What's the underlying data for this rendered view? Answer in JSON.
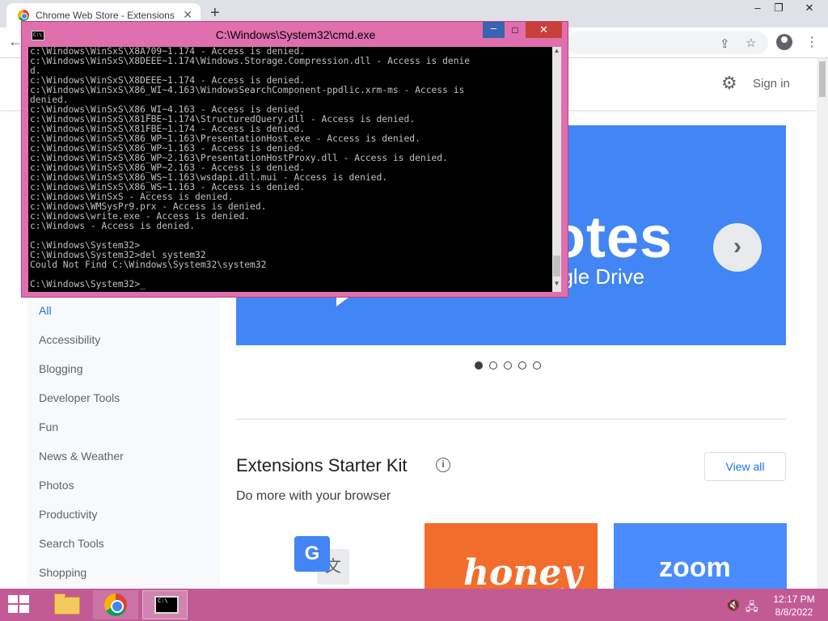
{
  "browser": {
    "tab_title": "Chrome Web Store - Extensions",
    "tab_close": "✕",
    "new_tab": "+",
    "minimize": "–",
    "maximize": "❐",
    "close": "✕"
  },
  "toolbar": {
    "back": "←",
    "share_icon": "⇪",
    "star_icon": "☆",
    "menu_icon": "⋮"
  },
  "store": {
    "settings_icon": "⚙",
    "sign_in": "Sign in"
  },
  "sidebar": {
    "categories": [
      {
        "label": "All",
        "active": true
      },
      {
        "label": "Accessibility"
      },
      {
        "label": "Blogging"
      },
      {
        "label": "Developer Tools"
      },
      {
        "label": "Fun"
      },
      {
        "label": "News & Weather"
      },
      {
        "label": "Photos"
      },
      {
        "label": "Productivity"
      },
      {
        "label": "Search Tools"
      },
      {
        "label": "Shopping"
      }
    ]
  },
  "banner": {
    "headline_partial": "otes",
    "sub_partial": "ogle Drive",
    "next": "›",
    "dots": 5,
    "active_dot": 0
  },
  "section": {
    "title": "Extensions Starter Kit",
    "info": "i",
    "subtitle": "Do more with your browser",
    "view_all": "View all"
  },
  "tiles": {
    "translate_g": "G",
    "translate_x": "文",
    "honey": "honey",
    "zoom": "zoom"
  },
  "cmd": {
    "title": "C:\\Windows\\System32\\cmd.exe",
    "icon_text": "C:\\",
    "minimize": "–",
    "maximize": "□",
    "close": "✕",
    "lines": [
      "c:\\Windows\\WinSxS\\X8A709~1.174 - Access is denied.",
      "c:\\Windows\\WinSxS\\X8DEEE~1.174\\Windows.Storage.Compression.dll - Access is denie",
      "d.",
      "c:\\Windows\\WinSxS\\X8DEEE~1.174 - Access is denied.",
      "c:\\Windows\\WinSxS\\X86_WI~4.163\\WindowsSearchComponent-ppdlic.xrm-ms - Access is",
      "denied.",
      "c:\\Windows\\WinSxS\\X86_WI~4.163 - Access is denied.",
      "c:\\Windows\\WinSxS\\X81FBE~1.174\\StructuredQuery.dll - Access is denied.",
      "c:\\Windows\\WinSxS\\X81FBE~1.174 - Access is denied.",
      "c:\\Windows\\WinSxS\\X86_WP~1.163\\PresentationHost.exe - Access is denied.",
      "c:\\Windows\\WinSxS\\X86_WP~1.163 - Access is denied.",
      "c:\\Windows\\WinSxS\\X86_WP~2.163\\PresentationHostProxy.dll - Access is denied.",
      "c:\\Windows\\WinSxS\\X86_WP~2.163 - Access is denied.",
      "c:\\Windows\\WinSxS\\X86_WS~1.163\\wsdapi.dll.mui - Access is denied.",
      "c:\\Windows\\WinSxS\\X86_WS~1.163 - Access is denied.",
      "c:\\Windows\\WinSxS - Access is denied.",
      "c:\\Windows\\WMSysPr9.prx - Access is denied.",
      "c:\\Windows\\write.exe - Access is denied.",
      "c:\\Windows - Access is denied.",
      "",
      "C:\\Windows\\System32>",
      "C:\\Windows\\System32>del system32",
      "Could Not Find C:\\Windows\\System32\\system32",
      "",
      "C:\\Windows\\System32>_"
    ]
  },
  "taskbar": {
    "cmd_icon_text": "C:\\",
    "volume_icon": "🔇",
    "network_icon": "🖧",
    "time": "12:17 PM",
    "date": "8/8/2022"
  }
}
